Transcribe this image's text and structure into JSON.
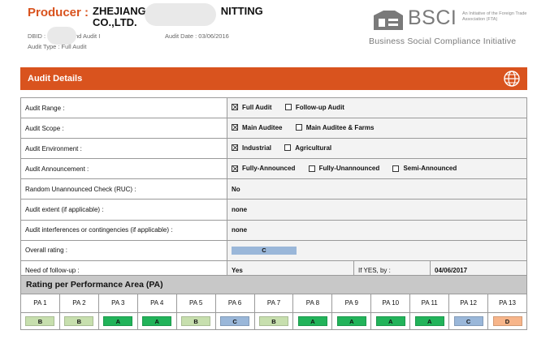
{
  "header": {
    "producer_label": "Producer :",
    "producer_name_part1": "ZHEJIANG",
    "producer_name_part2": "NITTING",
    "producer_name_line2": "CO.,LTD.",
    "dbid_label": "DBID :",
    "audit_id_fragment": "nd Audit I",
    "audit_date": "Audit Date : 03/06/2016",
    "audit_type": "Audit Type : Full Audit"
  },
  "logo": {
    "brand": "BSCI",
    "note": "An Initiative of the Foreign Trade Association (FTA)",
    "tagline": "Business Social Compliance Initiative"
  },
  "section": {
    "title": "Audit Details"
  },
  "details": {
    "range": {
      "label": "Audit Range :",
      "opts": [
        "Full Audit",
        "Follow-up Audit"
      ],
      "checked": [
        true,
        false
      ]
    },
    "scope": {
      "label": "Audit Scope :",
      "opts": [
        "Main Auditee",
        "Main Auditee & Farms"
      ],
      "checked": [
        true,
        false
      ]
    },
    "environment": {
      "label": "Audit Environment :",
      "opts": [
        "Industrial",
        "Agricultural"
      ],
      "checked": [
        true,
        false
      ]
    },
    "announcement": {
      "label": "Audit Announcement :",
      "opts": [
        "Fully-Announced",
        "Fully-Unannounced",
        "Semi-Announced"
      ],
      "checked": [
        true,
        false,
        false
      ]
    },
    "ruc": {
      "label": "Random Unannounced Check (RUC) :",
      "value": "No"
    },
    "extent": {
      "label": "Audit extent (if applicable) :",
      "value": "none"
    },
    "interferences": {
      "label": "Audit interferences or contingencies (if applicable) :",
      "value": "none"
    },
    "overall": {
      "label": "Overall rating :",
      "value": "C"
    },
    "followup": {
      "label": "Need of follow-up :",
      "value": "Yes",
      "if_yes_label": "If YES, by :",
      "date": "04/06/2017"
    }
  },
  "pa": {
    "title": "Rating per Performance Area (PA)",
    "labels": [
      "PA 1",
      "PA 2",
      "PA 3",
      "PA 4",
      "PA 5",
      "PA 6",
      "PA 7",
      "PA 8",
      "PA 9",
      "PA 10",
      "PA 11",
      "PA 12",
      "PA 13"
    ],
    "ratings": [
      "B",
      "B",
      "A",
      "A",
      "B",
      "C",
      "B",
      "A",
      "A",
      "A",
      "A",
      "C",
      "D"
    ]
  },
  "colors": {
    "accent": "#d9531e",
    "rating_A": "#22b35a",
    "rating_B": "#c7dfae",
    "rating_C": "#9ab7d9",
    "rating_D": "#f7b58a"
  }
}
